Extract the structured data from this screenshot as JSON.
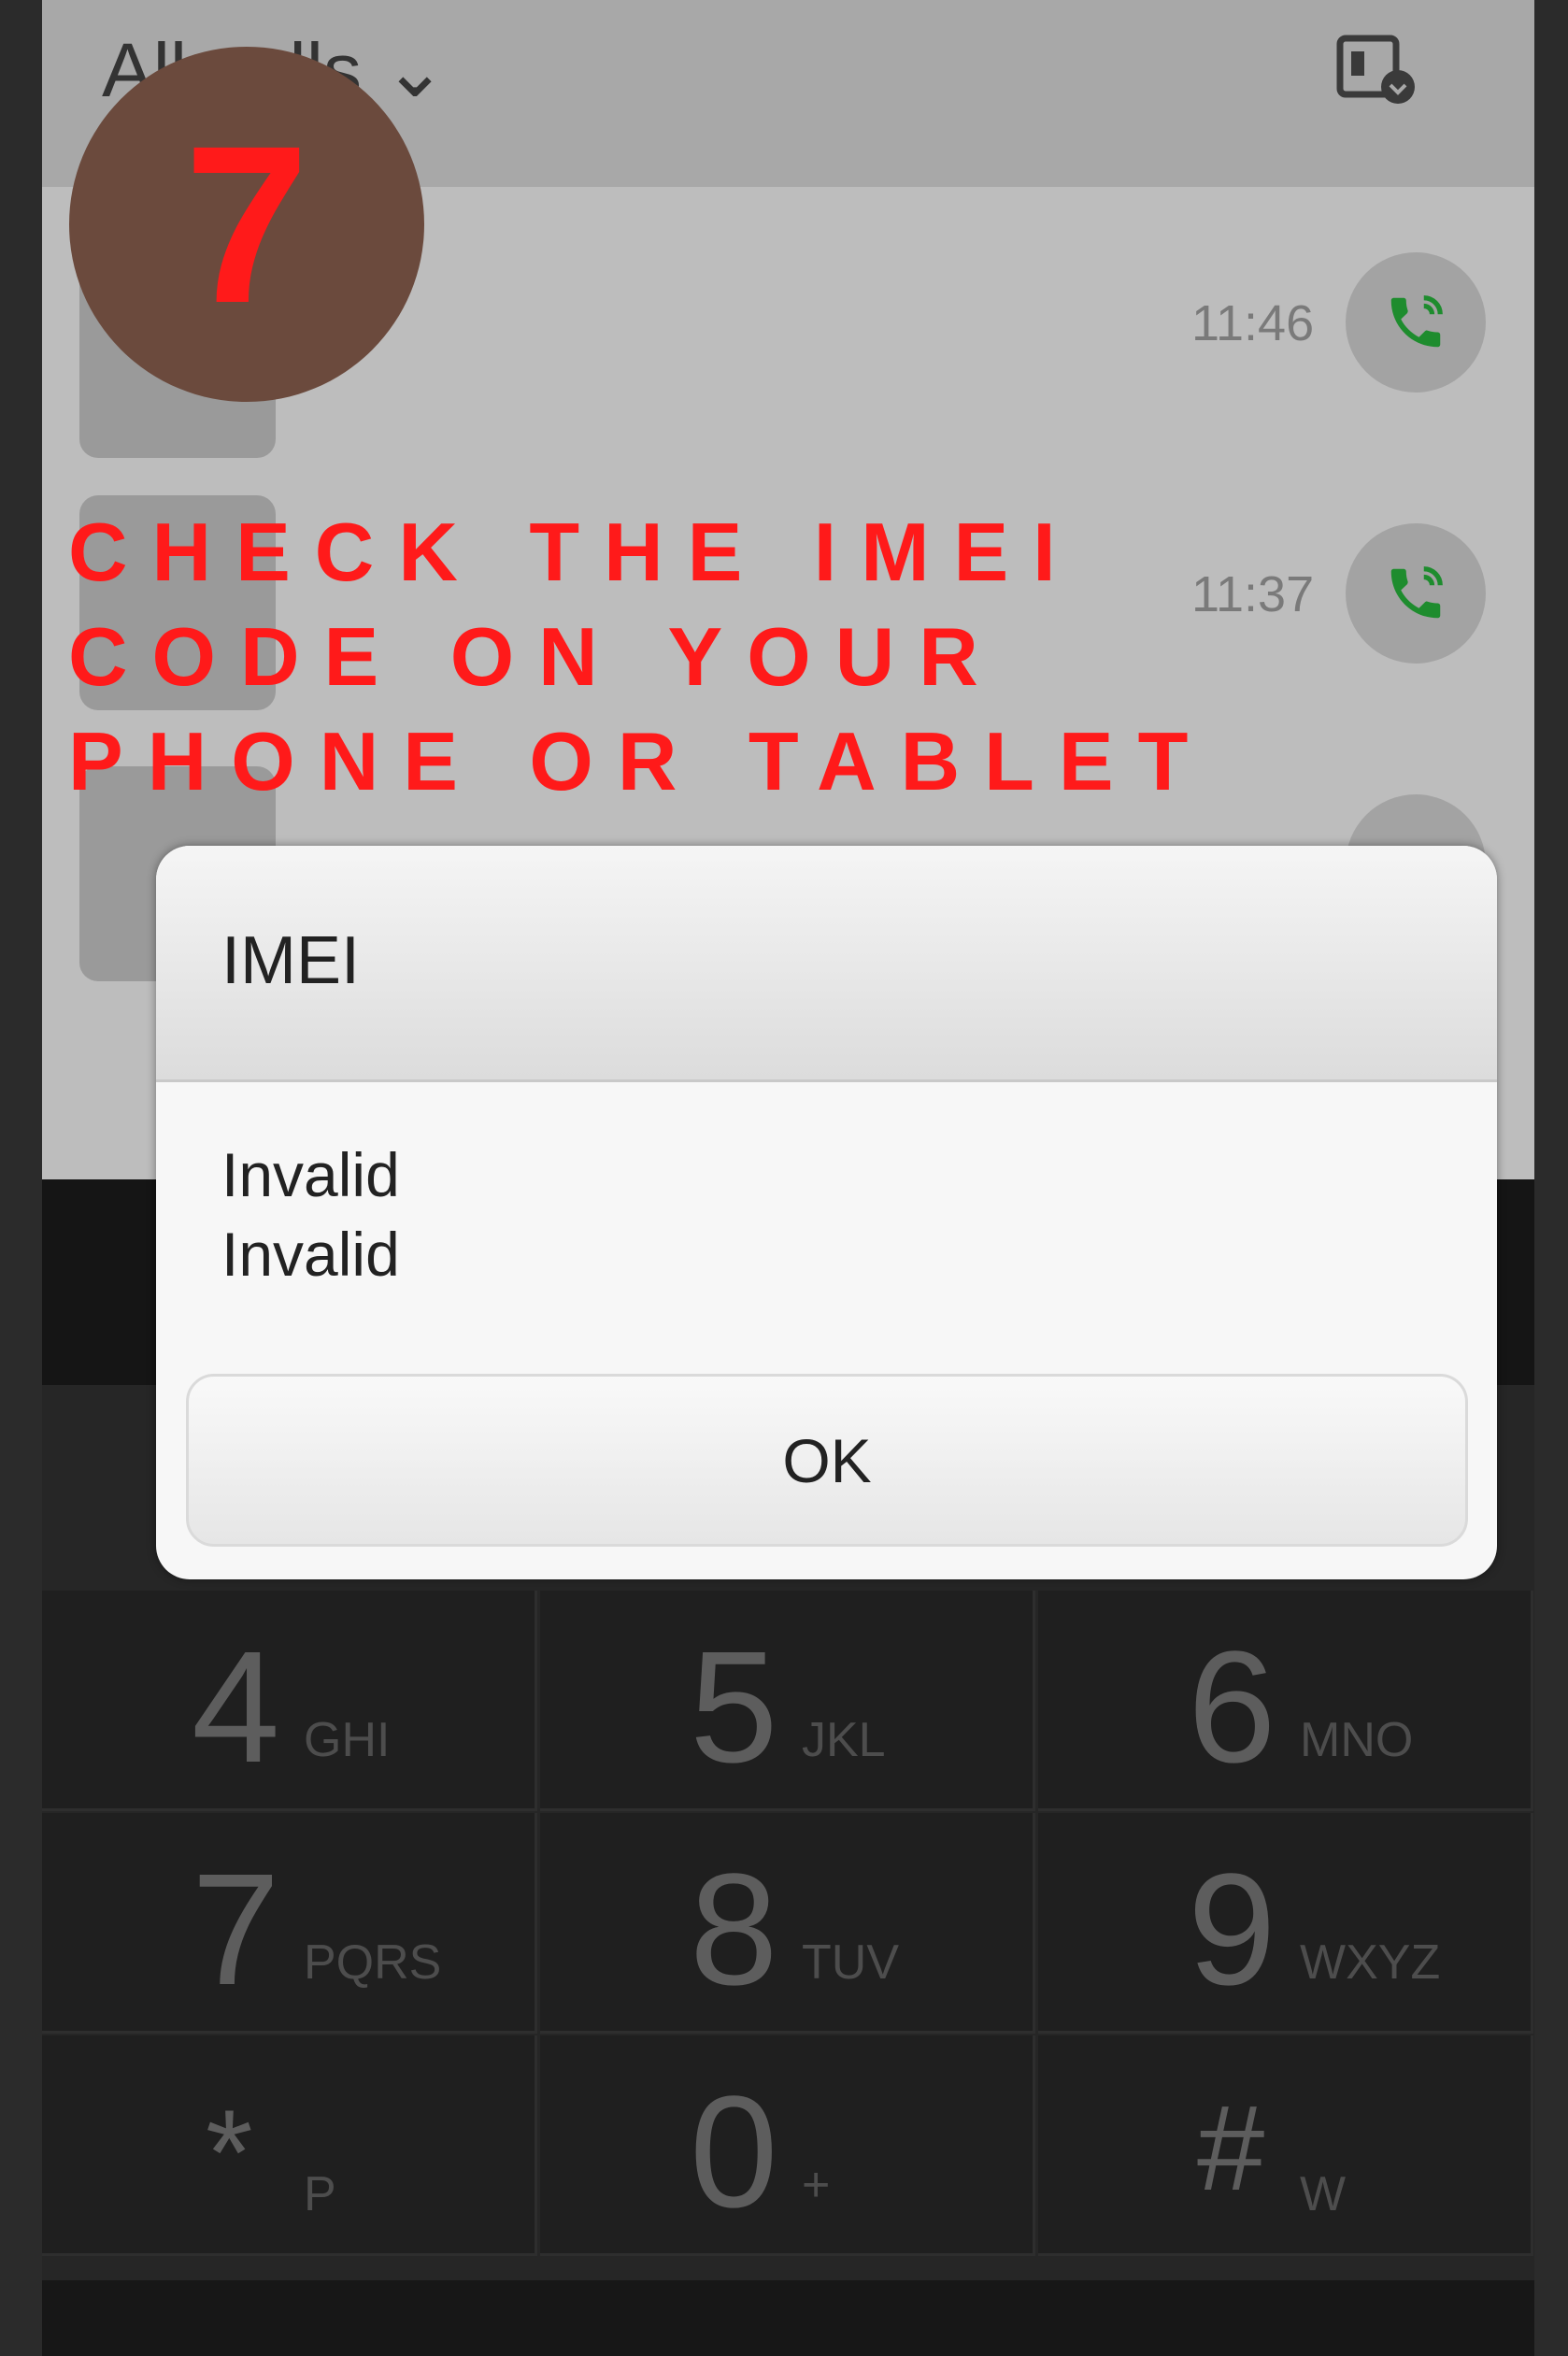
{
  "header": {
    "filter_label": "All calls",
    "chevron": "chevron-down-icon",
    "sim_icon": "sim-card-icon"
  },
  "call_log": [
    {
      "time": "11:46",
      "icon": "phone-call-icon"
    },
    {
      "time": "11:37",
      "icon": "phone-call-icon"
    },
    {
      "time": "",
      "icon": "phone-call-icon"
    }
  ],
  "overlay": {
    "step_number": "7",
    "caption": "CHECK THE IMEI CODE ON YOUR PHONE OR TABLET"
  },
  "dialog": {
    "title": "IMEI",
    "line1": "Invalid",
    "line2": "Invalid",
    "ok_label": "OK"
  },
  "keypad": [
    {
      "digit": "4",
      "letters": "GHI"
    },
    {
      "digit": "5",
      "letters": "JKL"
    },
    {
      "digit": "6",
      "letters": "MNO"
    },
    {
      "digit": "7",
      "letters": "PQRS"
    },
    {
      "digit": "8",
      "letters": "TUV"
    },
    {
      "digit": "9",
      "letters": "WXYZ"
    },
    {
      "digit": "*",
      "letters": "P"
    },
    {
      "digit": "0",
      "letters": "+"
    },
    {
      "digit": "#",
      "letters": "W"
    }
  ],
  "colors": {
    "accent_red": "#ff1a1a",
    "badge_brown": "#6b4a3d",
    "call_green": "#1e8c2e"
  }
}
